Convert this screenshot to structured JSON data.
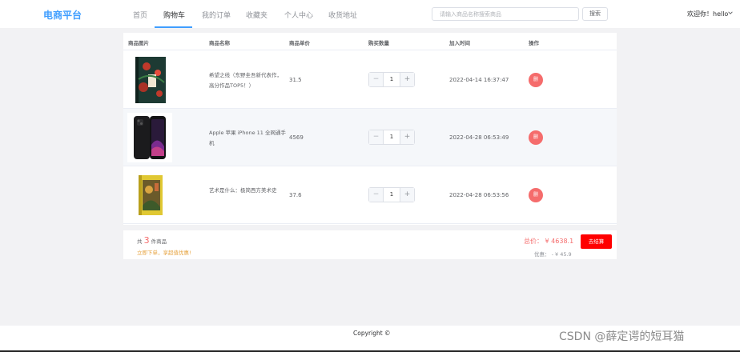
{
  "brand": "电商平台",
  "nav": [
    "首页",
    "购物车",
    "我的订单",
    "收藏夹",
    "个人中心",
    "收货地址"
  ],
  "nav_active_index": 1,
  "search": {
    "placeholder": "请输入商品名称搜索商品",
    "button": "搜索"
  },
  "user": {
    "greeting": "欢迎你！hello"
  },
  "columns": {
    "image": "商品图片",
    "name": "商品名称",
    "price": "商品单价",
    "quantity": "购买数量",
    "added": "加入时间",
    "action": "操作"
  },
  "items": [
    {
      "name": "希望之线（东野圭吾新代表作，高分作品TOP5！）",
      "price": "31.5",
      "qty": "1",
      "added": "2022-04-14 16:37:47",
      "delete_label": "删",
      "minus": "−",
      "plus": "+",
      "image_icon": "book-cover-icon"
    },
    {
      "name": "Apple 苹果 iPhone 11 全网通手机",
      "price": "4569",
      "qty": "1",
      "added": "2022-04-28 06:53:49",
      "delete_label": "删",
      "minus": "−",
      "plus": "+",
      "image_icon": "phone-image-icon"
    },
    {
      "name": "艺术是什么：极简西方美术史",
      "price": "37.6",
      "qty": "1",
      "added": "2022-04-28 06:53:56",
      "delete_label": "删",
      "minus": "−",
      "plus": "+",
      "image_icon": "book-cover-icon"
    }
  ],
  "summary": {
    "count_prefix": "共",
    "count": "3",
    "count_suffix": "件商品",
    "promo": "立即下单，享超值优惠!",
    "total_label": "总价：",
    "total_value": "¥ 4638.1",
    "discount_label": "优惠：",
    "discount_value": "- ¥ 45.9",
    "checkout": "去结算"
  },
  "footer": {
    "copyright": "Copyright ©"
  },
  "watermark": "CSDN @薛定谔的短耳猫",
  "colors": {
    "accent": "#409eff",
    "danger": "#f56c6c",
    "checkout": "#ff0000",
    "promo": "#e6a23c"
  }
}
